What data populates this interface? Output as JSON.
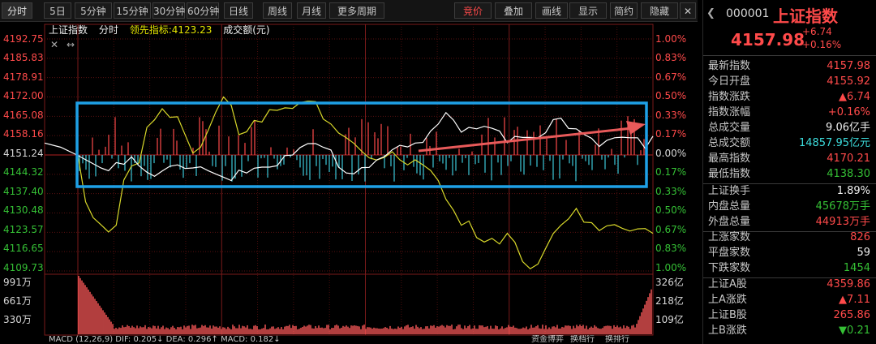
{
  "toolbar": {
    "tabs": [
      "分时",
      "5日",
      "5分钟",
      "15分钟",
      "30分钟",
      "60分钟",
      "日线",
      "周线",
      "月线",
      "更多周期"
    ],
    "right": [
      "竞价",
      "叠加",
      "画线",
      "显示",
      "简约",
      "隐藏"
    ]
  },
  "legend": {
    "name": "上证指数",
    "mode": "分时",
    "lead": "领先指标:4123.23",
    "amount": "成交额(元)"
  },
  "axis_left": [
    "4192.75",
    "4185.83",
    "4178.91",
    "4172.00",
    "4165.08",
    "4158.16",
    "4151.24",
    "4144.32",
    "4137.40",
    "4130.48",
    "4123.57",
    "4116.65",
    "4109.73"
  ],
  "axis_right": [
    "1.00%",
    "0.83%",
    "0.67%",
    "0.50%",
    "0.33%",
    "0.17%",
    "0.00%",
    "0.17%",
    "0.33%",
    "0.50%",
    "0.67%",
    "0.83%",
    "1.00%"
  ],
  "volume_left": [
    "991万",
    "661万",
    "330万"
  ],
  "volume_right": [
    "326亿",
    "218亿",
    "109亿"
  ],
  "macd_text": "MACD (12,26,9)   DIF: 0.205↓   DEA: 0.296↑   MACD: 0.182↓",
  "bottom_links": [
    "资金博弈",
    "换档行",
    "换排行"
  ],
  "chart_data": {
    "type": "line",
    "title": "上证指数",
    "ylim": [
      4109.73,
      4192.75
    ],
    "prev_close": 4151.24,
    "series": [
      {
        "name": "上证指数",
        "values": [
          4155.5,
          4154.0,
          4151.2,
          4146.6,
          4145.6,
          4148.5,
          4147.9,
          4150.6,
          4147.3,
          4145.1,
          4143.6,
          4145.5,
          4147.2,
          4147.7,
          4146.4,
          4146.6,
          4147.0,
          4145.6,
          4144.4,
          4143.3,
          4142.1,
          4145.8,
          4144.8,
          4146.5,
          4146.9,
          4146.9,
          4147.4,
          4151.0,
          4151.2,
          4153.9,
          4155.3,
          4155.3,
          4154.0,
          4153.0,
          4146.9,
          4144.8,
          4144.5,
          4146.7,
          4146.8,
          4149.5,
          4150.7,
          4153.1,
          4154.7,
          4154.1,
          4155.5,
          4155.7,
          4159.8,
          4162.3,
          4166.4,
          4163.7,
          4159.4,
          4161.1,
          4160.6,
          4161.5,
          4160.8,
          4159.8,
          4155.6,
          4157.9,
          4157.5,
          4157.5,
          4157.4,
          4159.2,
          4163.9,
          4164.4,
          4160.7,
          4160.6,
          4158.6,
          4157.2,
          4154.3,
          4156.5,
          4157.4,
          4157.6,
          4157.4,
          4157.4,
          4153.6,
          4157.98
        ]
      },
      {
        "name": "领先指标",
        "values": [
          4151.2,
          4134.5,
          4128.8,
          4126.3,
          4123.7,
          4126.1,
          4142.3,
          4147.3,
          4148.4,
          4161.1,
          4163.8,
          4167.8,
          4164.7,
          4164.9,
          4158.4,
          4151.9,
          4154.0,
          4160.1,
          4166.7,
          4172.0,
          4169.0,
          4158.5,
          4159.5,
          4163.6,
          4163.0,
          4167.4,
          4167.2,
          4168.1,
          4167.9,
          4170.0,
          4170.5,
          4170.3,
          4164.1,
          4162.3,
          4159.1,
          4157.4,
          4155.4,
          4152.6,
          4150.2,
          4149.4,
          4150.4,
          4152.4,
          4149.5,
          4147.7,
          4149.5,
          4147.7,
          4145.7,
          4142.1,
          4135.4,
          4131.4,
          4126.1,
          4127.6,
          4121.7,
          4120.1,
          4121.4,
          4119.4,
          4123.2,
          4120.0,
          4113.1,
          4110.5,
          4112.2,
          4117.8,
          4123.1,
          4126.1,
          4128.4,
          4132.1,
          4127.2,
          4127.0,
          4124.2,
          4125.9,
          4126.3,
          4125.0,
          4124.0,
          4124.8,
          4124.9,
          4123.2
        ]
      }
    ]
  },
  "quote": {
    "code": "000001",
    "name": "上证指数",
    "price": "4157.98",
    "change": "+6.74",
    "pct": "+0.16%"
  },
  "stats1": [
    {
      "k": "最新指数",
      "v": "4157.98",
      "c": "red"
    },
    {
      "k": "今日开盘",
      "v": "4155.92",
      "c": "red"
    },
    {
      "k": "指数涨跌",
      "v": "▲6.74",
      "c": "red"
    },
    {
      "k": "指数涨幅",
      "v": "+0.16%",
      "c": "red"
    },
    {
      "k": "总成交量",
      "v": "9.06亿手",
      "c": "white"
    },
    {
      "k": "总成交额",
      "v": "14857.95亿元",
      "c": "cyan"
    },
    {
      "k": "最高指数",
      "v": "4170.21",
      "c": "red"
    },
    {
      "k": "最低指数",
      "v": "4138.30",
      "c": "green"
    }
  ],
  "stats2": [
    {
      "k": "上证换手",
      "v": "1.89%",
      "c": "white"
    },
    {
      "k": "内盘总量",
      "v": "45678万手",
      "c": "green"
    },
    {
      "k": "外盘总量",
      "v": "44913万手",
      "c": "red"
    }
  ],
  "stats3": [
    {
      "k": "上涨家数",
      "v": "826",
      "c": "red"
    },
    {
      "k": "平盘家数",
      "v": "59",
      "c": "white"
    },
    {
      "k": "下跌家数",
      "v": "1454",
      "c": "green"
    }
  ],
  "stats4": [
    {
      "k": "上证A股",
      "v": "4359.86",
      "c": "red"
    },
    {
      "k": "上A涨跌",
      "v": "▲7.11",
      "c": "red"
    },
    {
      "k": "上证B股",
      "v": "265.86",
      "c": "red"
    },
    {
      "k": "上B涨跌",
      "v": "▼0.21",
      "c": "green"
    }
  ],
  "colors": {
    "up": "#ff4a4a",
    "down": "#35c035",
    "price_line": "#ffffff",
    "lead_line": "#d9d92a",
    "highlight_box": "#1ea0e6",
    "arrow": "#e85a5a"
  }
}
